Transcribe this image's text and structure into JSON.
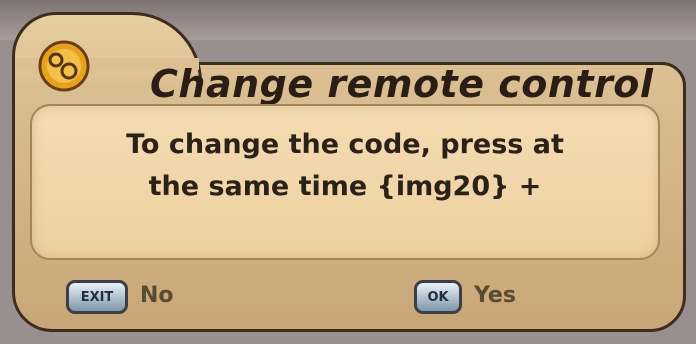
{
  "dialog": {
    "title": "Change remote control",
    "message_line1": "To change the code, press at",
    "message_line2": "the same time {img20} +"
  },
  "buttons": {
    "no": {
      "key": "EXIT",
      "label": "No"
    },
    "yes": {
      "key": "OK",
      "label": "Yes"
    }
  },
  "colors": {
    "dialog_background": "#dcc093",
    "message_background": "#f4dcb2",
    "border": "#3e2c1e",
    "icon_orange": "#e8a11c"
  },
  "icons": {
    "title_icon": "gear-icon"
  }
}
